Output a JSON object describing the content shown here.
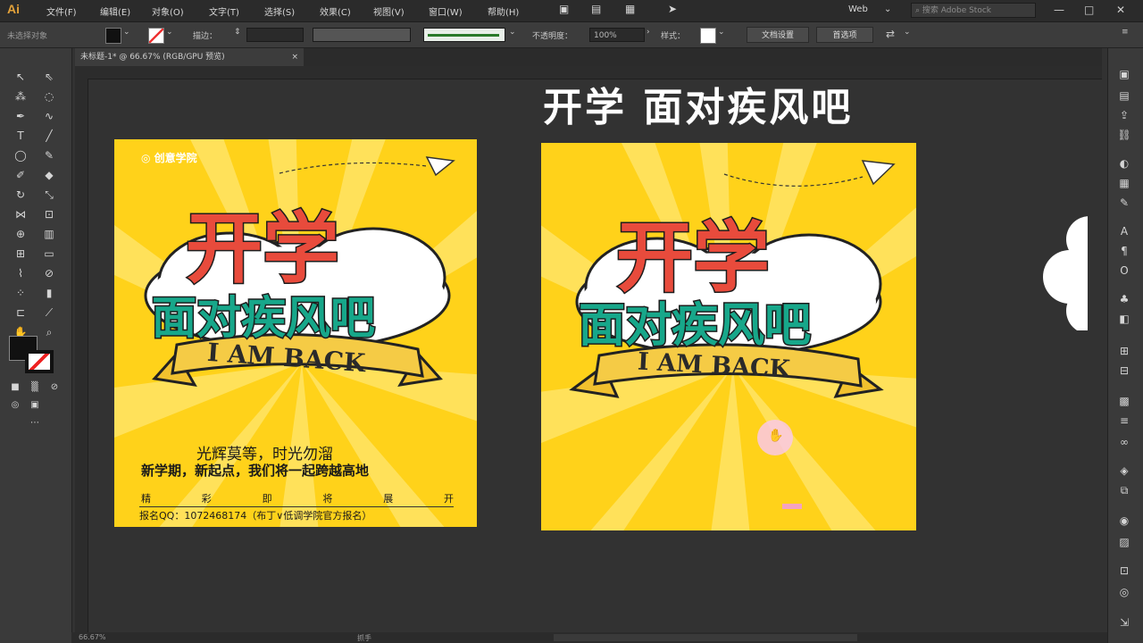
{
  "app": {
    "logo": "Ai",
    "menus": [
      "文件(F)",
      "编辑(E)",
      "对象(O)",
      "文字(T)",
      "选择(S)",
      "效果(C)",
      "视图(V)",
      "窗口(W)",
      "帮助(H)"
    ],
    "workspace": "Web",
    "search_placeholder": "搜索 Adobe Stock"
  },
  "control_bar": {
    "selection_label": "未选择对象",
    "stroke_label": "描边：",
    "opacity_label": "不透明度：",
    "opacity_value": "100%",
    "style_label": "样式：",
    "doc_setup_button": "文档设置",
    "prefs_button": "首选项"
  },
  "document_tab": {
    "label": "未标题-1* @ 66.67% (RGB/GPU 预览)",
    "close": "×"
  },
  "status": {
    "zoom": "66.67%",
    "tool": "抓手"
  },
  "canvas": {
    "headline": "开学 面对疾风吧"
  },
  "poster_left": {
    "logo_text": "创意学院",
    "title": "开学",
    "subtitle": "面对疾风吧",
    "banner": "I AM BACK",
    "line1": "光辉莫等，时光勿溜",
    "line2": "新学期，新起点，我们将一起跨越高地",
    "line3_chars": [
      "精",
      "彩",
      "即",
      "将",
      "展",
      "开"
    ],
    "line4": "报名QQ：1072468174（布丁∨低调学院官方报名）"
  },
  "poster_right": {
    "title": "开学",
    "subtitle": "面对疾风吧",
    "banner": "I AM BACK"
  },
  "colors": {
    "poster_yellow": "#ffd21a",
    "title_red": "#e84b3c",
    "subtitle_teal": "#17a78a",
    "ui_dark": "#323232"
  }
}
